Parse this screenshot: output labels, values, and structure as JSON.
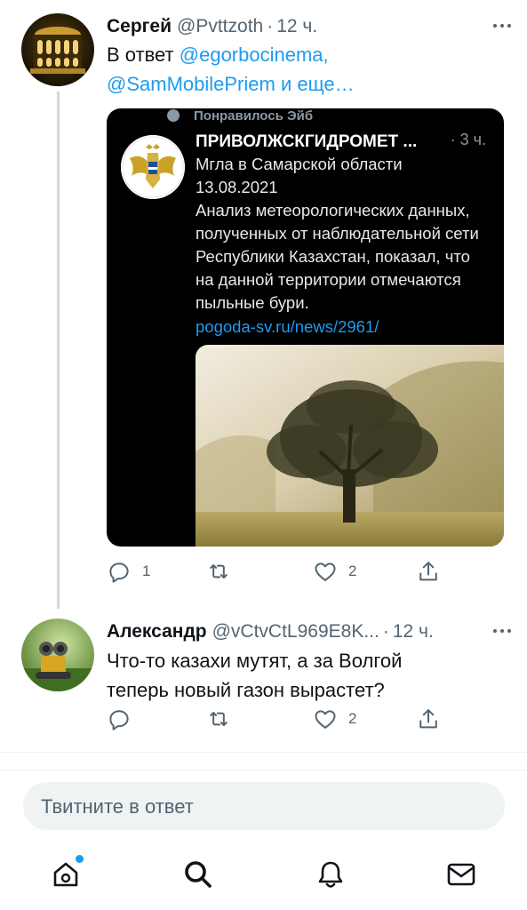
{
  "tweets": [
    {
      "name": "Сергей",
      "handle": "@Pvttzoth",
      "time": "12 ч.",
      "reply_prefix": "В ответ",
      "reply_user1": "@egorbocinema",
      "reply_comma": ",",
      "reply_user2": "@SamMobilePriem",
      "reply_suffix": " и еще…",
      "replies": "1",
      "likes": "2"
    },
    {
      "name": "Александр",
      "handle": "@vCtvCtL969E8K...",
      "time": "12 ч.",
      "text_line1": "Что-то казахи мутят, а за Волгой",
      "text_line2": "теперь новый газон вырастет?",
      "replies": "",
      "likes": "2"
    }
  ],
  "embed": {
    "liked_label": "Понравилось Эйб",
    "name": "ПРИВОЛЖСКГИДРОМЕТ ...",
    "time": "· 3 ч.",
    "text": "Мгла в Самарской области\n13.08.2021\nАнализ метеорологических данных,\nполученных от наблюдательной сети\nРеспублики Казахстан, показал, что\nна данной территории отмечаются\nпыльные бури.",
    "link": "pogoda-sv.ru/news/2961/"
  },
  "composer": {
    "placeholder": "Твитните в ответ"
  },
  "tabbar": {
    "icons": [
      "home-icon",
      "search-icon",
      "notifications-icon",
      "messages-icon"
    ],
    "badge_color": "#1d9bf0"
  },
  "colors": {
    "accent": "#1d9bf0",
    "secondary_text": "#536471"
  }
}
